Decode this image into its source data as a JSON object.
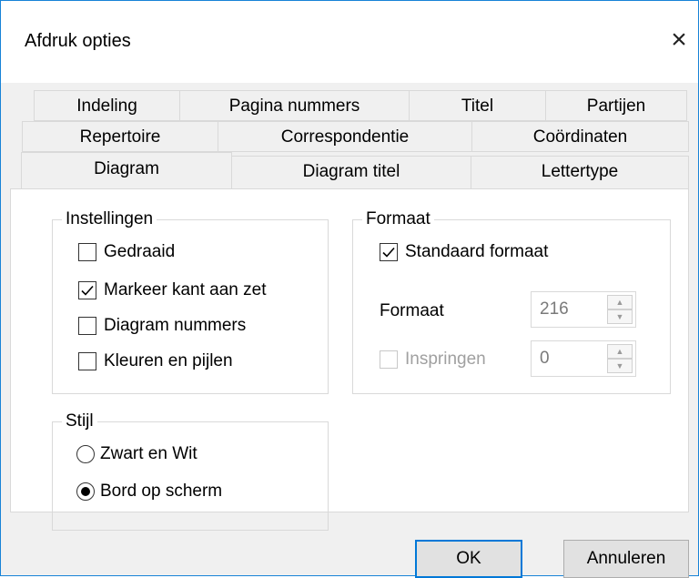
{
  "window": {
    "title": "Afdruk opties",
    "close_icon": "×"
  },
  "tabs": {
    "row1": [
      "Indeling",
      "Pagina nummers",
      "Titel",
      "Partijen"
    ],
    "row2": [
      "Repertoire",
      "Correspondentie",
      "Coördinaten"
    ],
    "row3": [
      "Diagram",
      "Diagram titel",
      "Lettertype"
    ],
    "selected": "Diagram"
  },
  "instellingen": {
    "legend": "Instellingen",
    "options": [
      {
        "label": "Gedraaid",
        "checked": false
      },
      {
        "label": "Markeer kant aan zet",
        "checked": true
      },
      {
        "label": "Diagram nummers",
        "checked": false
      },
      {
        "label": "Kleuren en pijlen",
        "checked": false
      }
    ]
  },
  "formaat": {
    "legend": "Formaat",
    "standaard_label": "Standaard formaat",
    "standaard_checked": true,
    "size_label": "Formaat",
    "size_value": "216",
    "indent_label": "Inspringen",
    "indent_checked": false,
    "indent_value": "0"
  },
  "stijl": {
    "legend": "Stijl",
    "options": [
      {
        "label": "Zwart en Wit",
        "selected": false
      },
      {
        "label": "Bord op scherm",
        "selected": true
      }
    ]
  },
  "buttons": {
    "ok": "OK",
    "cancel": "Annuleren"
  }
}
